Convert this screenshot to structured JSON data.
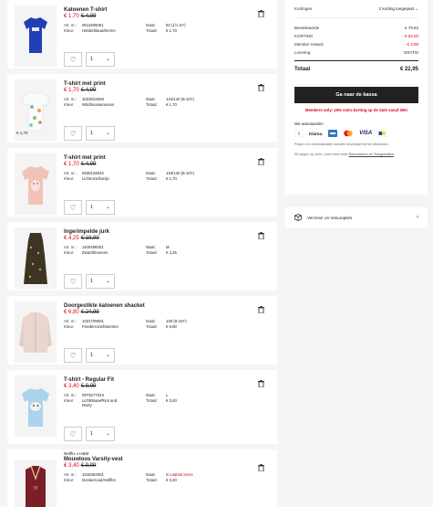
{
  "items": [
    {
      "brand": "",
      "title": "Katoenen T-shirt",
      "price_now": "€ 1,70",
      "price_was": "€ 4,99",
      "art_label": "Art. nr.:",
      "art": "0611605061",
      "size_label": "Maat:",
      "size": "92 (1½-2Y)",
      "color_label": "Kleur:",
      "color": "Helderblauw/NASA",
      "total_label": "Totaal:",
      "total": "€ 1,70",
      "qty": "1",
      "img_badge": ""
    },
    {
      "brand": "",
      "title": "T-shirt met print",
      "price_now": "€ 1,70",
      "price_was": "€ 4,99",
      "art_label": "Art. nr.:",
      "art": "1023634006",
      "size_label": "Maat:",
      "size": "134/140 (8-10Y)",
      "color_label": "Kleur:",
      "color": "Wit/dinosaurussen",
      "total_label": "Totaal:",
      "total": "€ 1,70",
      "qty": "1",
      "img_badge": "€ 1,70"
    },
    {
      "brand": "",
      "title": "T-shirt met print",
      "price_now": "€ 1,70",
      "price_was": "€ 4,99",
      "art_label": "Art. nr.:",
      "art": "0930126042",
      "size_label": "Maat:",
      "size": "134/140 (8-10Y)",
      "color_label": "Kleur:",
      "color": "Lichtroze/konijn",
      "total_label": "Totaal:",
      "total": "€ 1,70",
      "qty": "1",
      "img_badge": ""
    },
    {
      "brand": "",
      "title": "Ingerimpelde jurk",
      "price_now": "€ 4,25",
      "price_was": "€ 19,99",
      "art_label": "Art. nr.:",
      "art": "1100496001",
      "size_label": "Maat:",
      "size": "M",
      "color_label": "Kleur:",
      "color": "Zwart/bloemen",
      "total_label": "Totaal:",
      "total": "€ 4,25",
      "qty": "1",
      "img_badge": ""
    },
    {
      "brand": "",
      "title": "Doorgestikte katoenen shacket",
      "price_now": "€ 6,80",
      "price_was": "€ 24,99",
      "art_label": "Art. nr.:",
      "art": "1031709001",
      "size_label": "Maat:",
      "size": "140 (9-10Y)",
      "color_label": "Kleur:",
      "color": "Poederroze/bloemen",
      "total_label": "Totaal:",
      "total": "€ 6,80",
      "qty": "1",
      "img_badge": ""
    },
    {
      "brand": "",
      "title": "T-shirt - Regular Fit",
      "price_now": "€ 3,40",
      "price_was": "€ 9,99",
      "art_label": "Art. nr.:",
      "art": "0973277043",
      "size_label": "Maat:",
      "size": "L",
      "color_label": "Kleur:",
      "color": "Lichtblauw/Rick and Morty",
      "total_label": "Totaal:",
      "total": "€ 3,40",
      "qty": "1",
      "img_badge": ""
    },
    {
      "brand": "Netflix x H&M",
      "title": "Mouwloos Varsity-vest",
      "price_now": "€ 3,40",
      "price_was": "€ 9,99",
      "art_label": "Art. nr.:",
      "art": "1018352001",
      "size_label": "Maat:",
      "size": "S",
      "size_extra": "Laatste items",
      "color_label": "Kleur:",
      "color": "Donkerrood/Hellfire",
      "total_label": "Totaal:",
      "total": "€ 3,40",
      "qty": "1",
      "img_badge": ""
    }
  ],
  "summary": {
    "coupon_label": "Kortingen",
    "coupon_value": "1 korting toegepast",
    "rows": [
      {
        "label": "Bestelwaarde",
        "value": "€ 79,93",
        "neg": false
      },
      {
        "label": "KORTING",
        "value": "- € 53,00",
        "neg": true
      },
      {
        "label": "Member reward",
        "value": "- € 3,98",
        "neg": true
      },
      {
        "label": "Levering",
        "value": "GRATIS",
        "neg": false
      }
    ],
    "total_label": "Totaal",
    "total_value": "€ 22,95",
    "checkout_label": "Ga naar de kassa",
    "promo": "Members only: 15% extra korting op de Sale vanaf 25€!",
    "accept_label": "We aanvaarden",
    "payments": [
      "ideal",
      "klarna",
      "amex",
      "mastercard",
      "VISA",
      "bancontact"
    ],
    "klarna_text": "Klarna.",
    "visa_text": "VISA",
    "note1": "Prijzen en verzendkosten worden bevestigd bij het afrekenen.",
    "note2": "30 dagen op zicht. Lees meer over",
    "note2_link": "Retourneren en Terugbetalen"
  },
  "shipping": {
    "label": "Verzend- en retouropties"
  },
  "colors": {
    "sale_red": "#d6001c",
    "dark": "#222222",
    "bg": "#f5f5f5"
  }
}
